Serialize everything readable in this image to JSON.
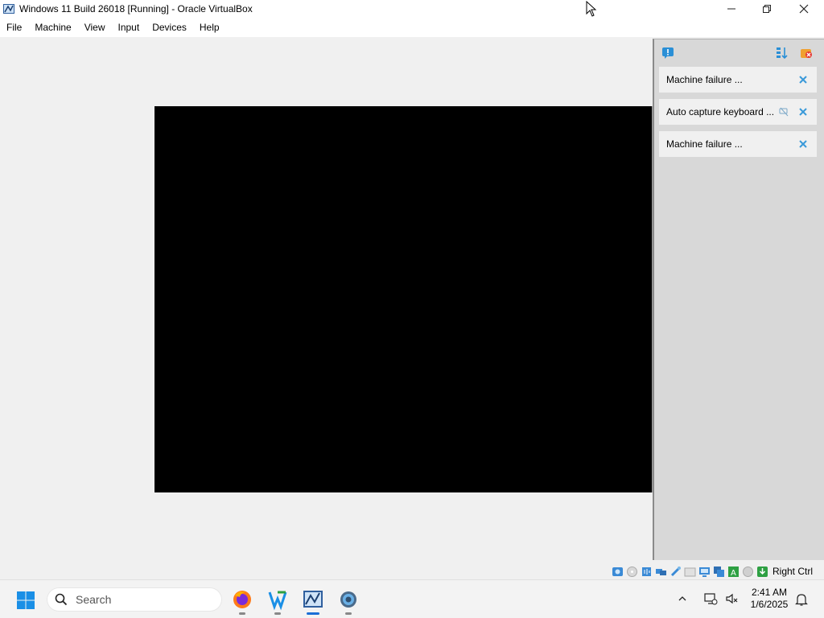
{
  "window": {
    "title": "Windows 11 Build 26018 [Running] - Oracle VirtualBox"
  },
  "menu": [
    "File",
    "Machine",
    "View",
    "Input",
    "Devices",
    "Help"
  ],
  "notifications": [
    {
      "label": "Machine failure ...",
      "muted": false
    },
    {
      "label": "Auto capture keyboard ...",
      "muted": true
    },
    {
      "label": "Machine failure ...",
      "muted": false
    }
  ],
  "statusbar": {
    "host_key": "Right Ctrl"
  },
  "taskbar": {
    "search_placeholder": "Search",
    "time": "2:41 AM",
    "date": "1/6/2025"
  }
}
